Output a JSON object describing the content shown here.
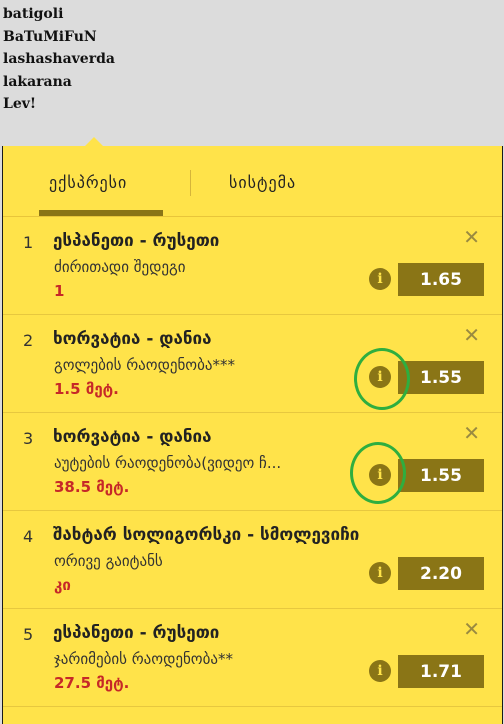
{
  "users": [
    "batigoli",
    "BaTuMiFuN",
    "lashashaverda",
    "lakarana",
    "Lev!"
  ],
  "tabs": {
    "express": "ექსპრესი",
    "system": "სისტემა"
  },
  "bets": [
    {
      "num": "1",
      "event": "ესპანეთი - რუსეთი",
      "market": "ძირითადი შედეგი",
      "outcome": "1",
      "odds": "1.65"
    },
    {
      "num": "2",
      "event": "ხორვატია - დანია",
      "market": "გოლების რაოდენობა***",
      "outcome": "1.5 მეტ.",
      "odds": "1.55"
    },
    {
      "num": "3",
      "event": "ხორვატია - დანია",
      "market": "აუტების რაოდენობა(ვიდეო ჩ...",
      "outcome": "38.5 მეტ.",
      "odds": "1.55"
    },
    {
      "num": "4",
      "event": "შახტარ სოლიგორსკი - სმოლევიჩი",
      "market": "ორივე გაიტანს",
      "outcome": "კი",
      "odds": "2.20"
    },
    {
      "num": "5",
      "event": "ესპანეთი - რუსეთი",
      "market": "ჯარიმების რაოდენობა**",
      "outcome": "27.5 მეტ.",
      "odds": "1.71"
    }
  ],
  "icons": {
    "close": "close-icon",
    "info": "info-icon"
  },
  "colors": {
    "panel": "#ffe34a",
    "accent": "#8a7516",
    "outcome": "#c62828",
    "highlight": "#2fae3f"
  }
}
